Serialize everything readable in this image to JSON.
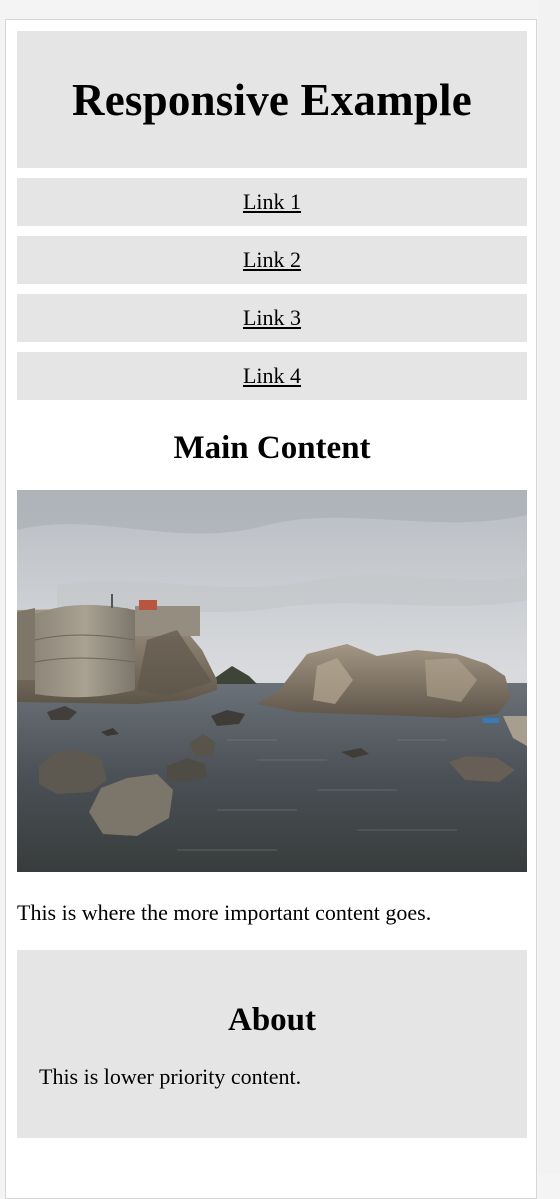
{
  "header": {
    "title": "Responsive Example"
  },
  "nav": {
    "links": [
      "Link 1",
      "Link 2",
      "Link 3",
      "Link 4"
    ]
  },
  "main": {
    "title": "Main Content",
    "text": "This is where the more important content goes."
  },
  "about": {
    "title": "About",
    "text": "This is lower priority content."
  }
}
